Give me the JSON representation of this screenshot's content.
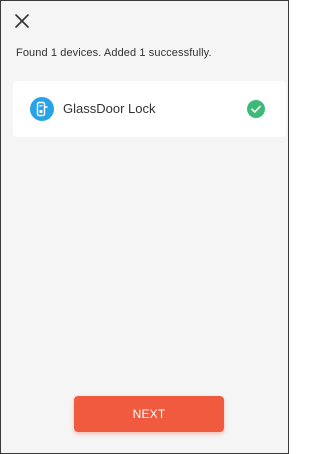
{
  "header": {
    "close_icon": "close-icon"
  },
  "summary": {
    "text": "Found 1 devices. Added 1 successfully."
  },
  "devices": [
    {
      "name": "GlassDoor Lock",
      "icon": "door-lock-icon",
      "status": "success",
      "status_icon": "check-circle-icon"
    }
  ],
  "footer": {
    "next_label": "NEXT"
  },
  "colors": {
    "background": "#f5f5f5",
    "card": "#ffffff",
    "device_icon_blue": "#29a3e8",
    "success_green": "#3dba78",
    "next_button": "#f05a3e",
    "text": "#333333"
  }
}
